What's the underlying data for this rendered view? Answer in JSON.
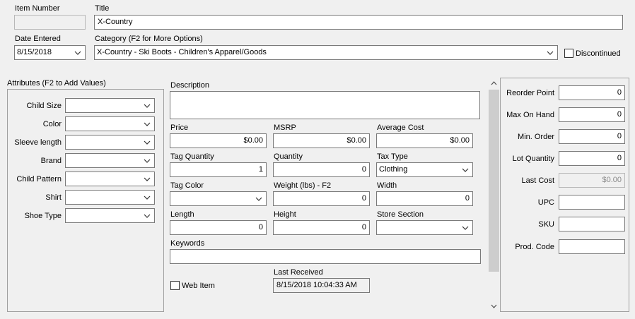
{
  "header": {
    "item_number_label": "Item Number",
    "item_number_value": "",
    "title_label": "Title",
    "title_value": "X-Country",
    "date_entered_label": "Date Entered",
    "date_entered_value": "8/15/2018",
    "category_label": "Category (F2 for More Options)",
    "category_value": "X-Country - Ski Boots - Children's Apparel/Goods",
    "discontinued_label": "Discontinued"
  },
  "attributes": {
    "label": "Attributes (F2 to Add Values)",
    "items": [
      {
        "label": "Child Size",
        "value": ""
      },
      {
        "label": "Color",
        "value": ""
      },
      {
        "label": "Sleeve length",
        "value": ""
      },
      {
        "label": "Brand",
        "value": ""
      },
      {
        "label": "Child Pattern",
        "value": ""
      },
      {
        "label": "Shirt",
        "value": ""
      },
      {
        "label": "Shoe Type",
        "value": ""
      }
    ]
  },
  "middle": {
    "description_label": "Description",
    "description_value": "",
    "price_label": "Price",
    "price_value": "$0.00",
    "msrp_label": "MSRP",
    "msrp_value": "$0.00",
    "avg_cost_label": "Average Cost",
    "avg_cost_value": "$0.00",
    "tag_qty_label": "Tag Quantity",
    "tag_qty_value": "1",
    "qty_label": "Quantity",
    "qty_value": "0",
    "tax_type_label": "Tax Type",
    "tax_type_value": "Clothing",
    "tag_color_label": "Tag Color",
    "tag_color_value": "",
    "weight_label": "Weight (lbs) - F2",
    "weight_value": "0",
    "width_label": "Width",
    "width_value": "0",
    "length_label": "Length",
    "length_value": "0",
    "height_label": "Height",
    "height_value": "0",
    "store_section_label": "Store Section",
    "store_section_value": "",
    "keywords_label": "Keywords",
    "keywords_value": "",
    "web_item_label": "Web Item",
    "last_received_label": "Last Received",
    "last_received_value": "8/15/2018 10:04:33 AM"
  },
  "right": {
    "reorder_point_label": "Reorder Point",
    "reorder_point_value": "0",
    "max_on_hand_label": "Max On Hand",
    "max_on_hand_value": "0",
    "min_order_label": "Min. Order",
    "min_order_value": "0",
    "lot_qty_label": "Lot Quantity",
    "lot_qty_value": "0",
    "last_cost_label": "Last Cost",
    "last_cost_value": "$0.00",
    "upc_label": "UPC",
    "upc_value": "",
    "sku_label": "SKU",
    "sku_value": "",
    "prod_code_label": "Prod. Code",
    "prod_code_value": ""
  }
}
